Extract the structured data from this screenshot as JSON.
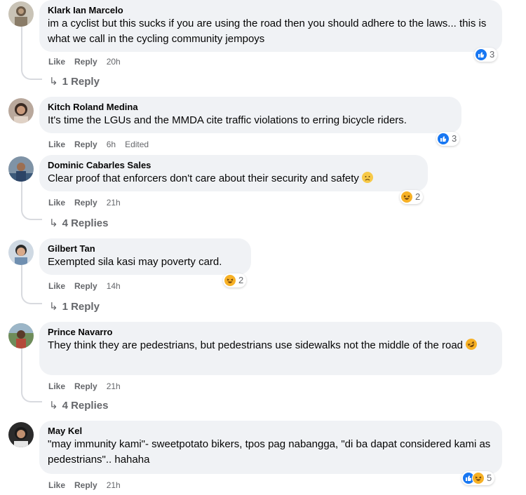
{
  "actions": {
    "like_label": "Like",
    "reply_label": "Reply"
  },
  "colors": {
    "bubble": "#f0f2f5",
    "meta_text": "#65676b",
    "like_blue": "#1877f2",
    "haha_yellow": "#f7b125"
  },
  "comments": [
    {
      "author": "Klark Ian Marcelo",
      "text": "im a cyclist but this sucks if you are using the road then you should adhere to the laws... this is what we call in the cycling community jempoys",
      "time": "20h",
      "reactions": [
        "like-icon"
      ],
      "reaction_count": "3",
      "replies_label": "1 Reply"
    },
    {
      "author": "Kitch Roland Medina",
      "text": "It's time the LGUs and the MMDA cite traffic violations to erring bicycle riders.",
      "time": "6h",
      "edited_label": "Edited",
      "reactions": [
        "like-icon"
      ],
      "reaction_count": "3"
    },
    {
      "author": "Dominic Cabarles Sales",
      "text": "Clear proof that enforcers don't care about their security and safety",
      "inline_emoji": "disappointed-face-emoji",
      "time": "21h",
      "reactions": [
        "haha-icon"
      ],
      "reaction_count": "2",
      "replies_label": "4 Replies"
    },
    {
      "author": "Gilbert Tan",
      "text": "Exempted sila kasi may poverty card.",
      "time": "14h",
      "reactions": [
        "haha-icon"
      ],
      "reaction_count": "2",
      "replies_label": "1 Reply"
    },
    {
      "author": "Prince Navarro",
      "text": "They think they are pedestrians, but pedestrians use sidewalks not the middle of the road",
      "inline_emoji": "rolling-laughing-emoji",
      "time": "21h",
      "replies_label": "4 Replies"
    },
    {
      "author": "May Kel",
      "text": "\"may immunity kami\"- sweetpotato bikers, tpos pag nabangga, \"di ba dapat considered kami as pedestrians\".. hahaha",
      "time": "21h",
      "reactions": [
        "like-icon",
        "haha-icon"
      ],
      "reaction_count": "5"
    }
  ]
}
